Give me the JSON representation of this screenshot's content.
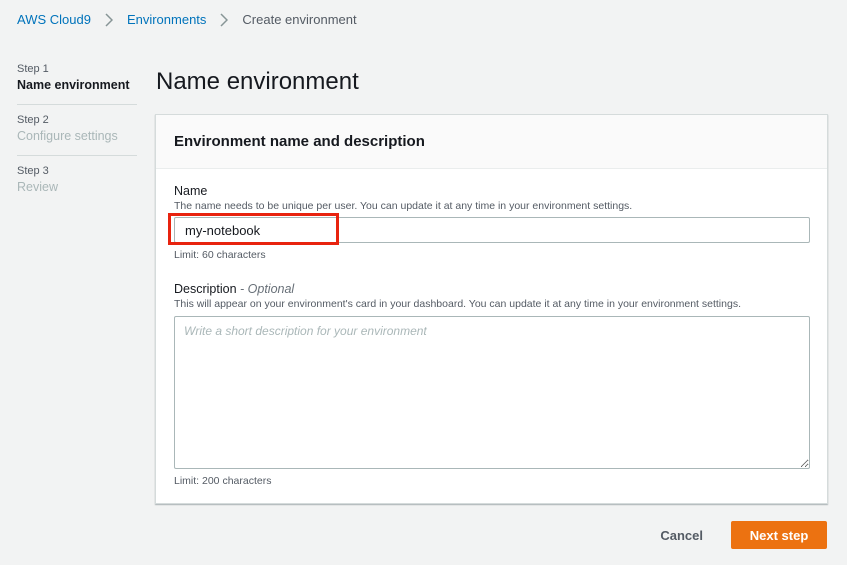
{
  "breadcrumb": {
    "items": [
      "AWS Cloud9",
      "Environments"
    ],
    "current": "Create environment"
  },
  "steps": [
    {
      "number": "Step 1",
      "label": "Name environment",
      "active": true
    },
    {
      "number": "Step 2",
      "label": "Configure settings",
      "active": false
    },
    {
      "number": "Step 3",
      "label": "Review",
      "active": false
    }
  ],
  "page": {
    "title": "Name environment"
  },
  "panel": {
    "header": "Environment name and description",
    "name": {
      "label": "Name",
      "description": "The name needs to be unique per user. You can update it at any time in your environment settings.",
      "value": "my-notebook",
      "hint": "Limit: 60 characters"
    },
    "description": {
      "label": "Description",
      "optional": "- Optional",
      "help": "This will appear on your environment's card in your dashboard. You can update it at any time in your environment settings.",
      "placeholder": "Write a short description for your environment",
      "hint": "Limit: 200 characters"
    }
  },
  "actions": {
    "cancel": "Cancel",
    "next": "Next step"
  },
  "colors": {
    "link": "#0073bb",
    "primary": "#ec7211",
    "highlight": "#e8230f"
  }
}
